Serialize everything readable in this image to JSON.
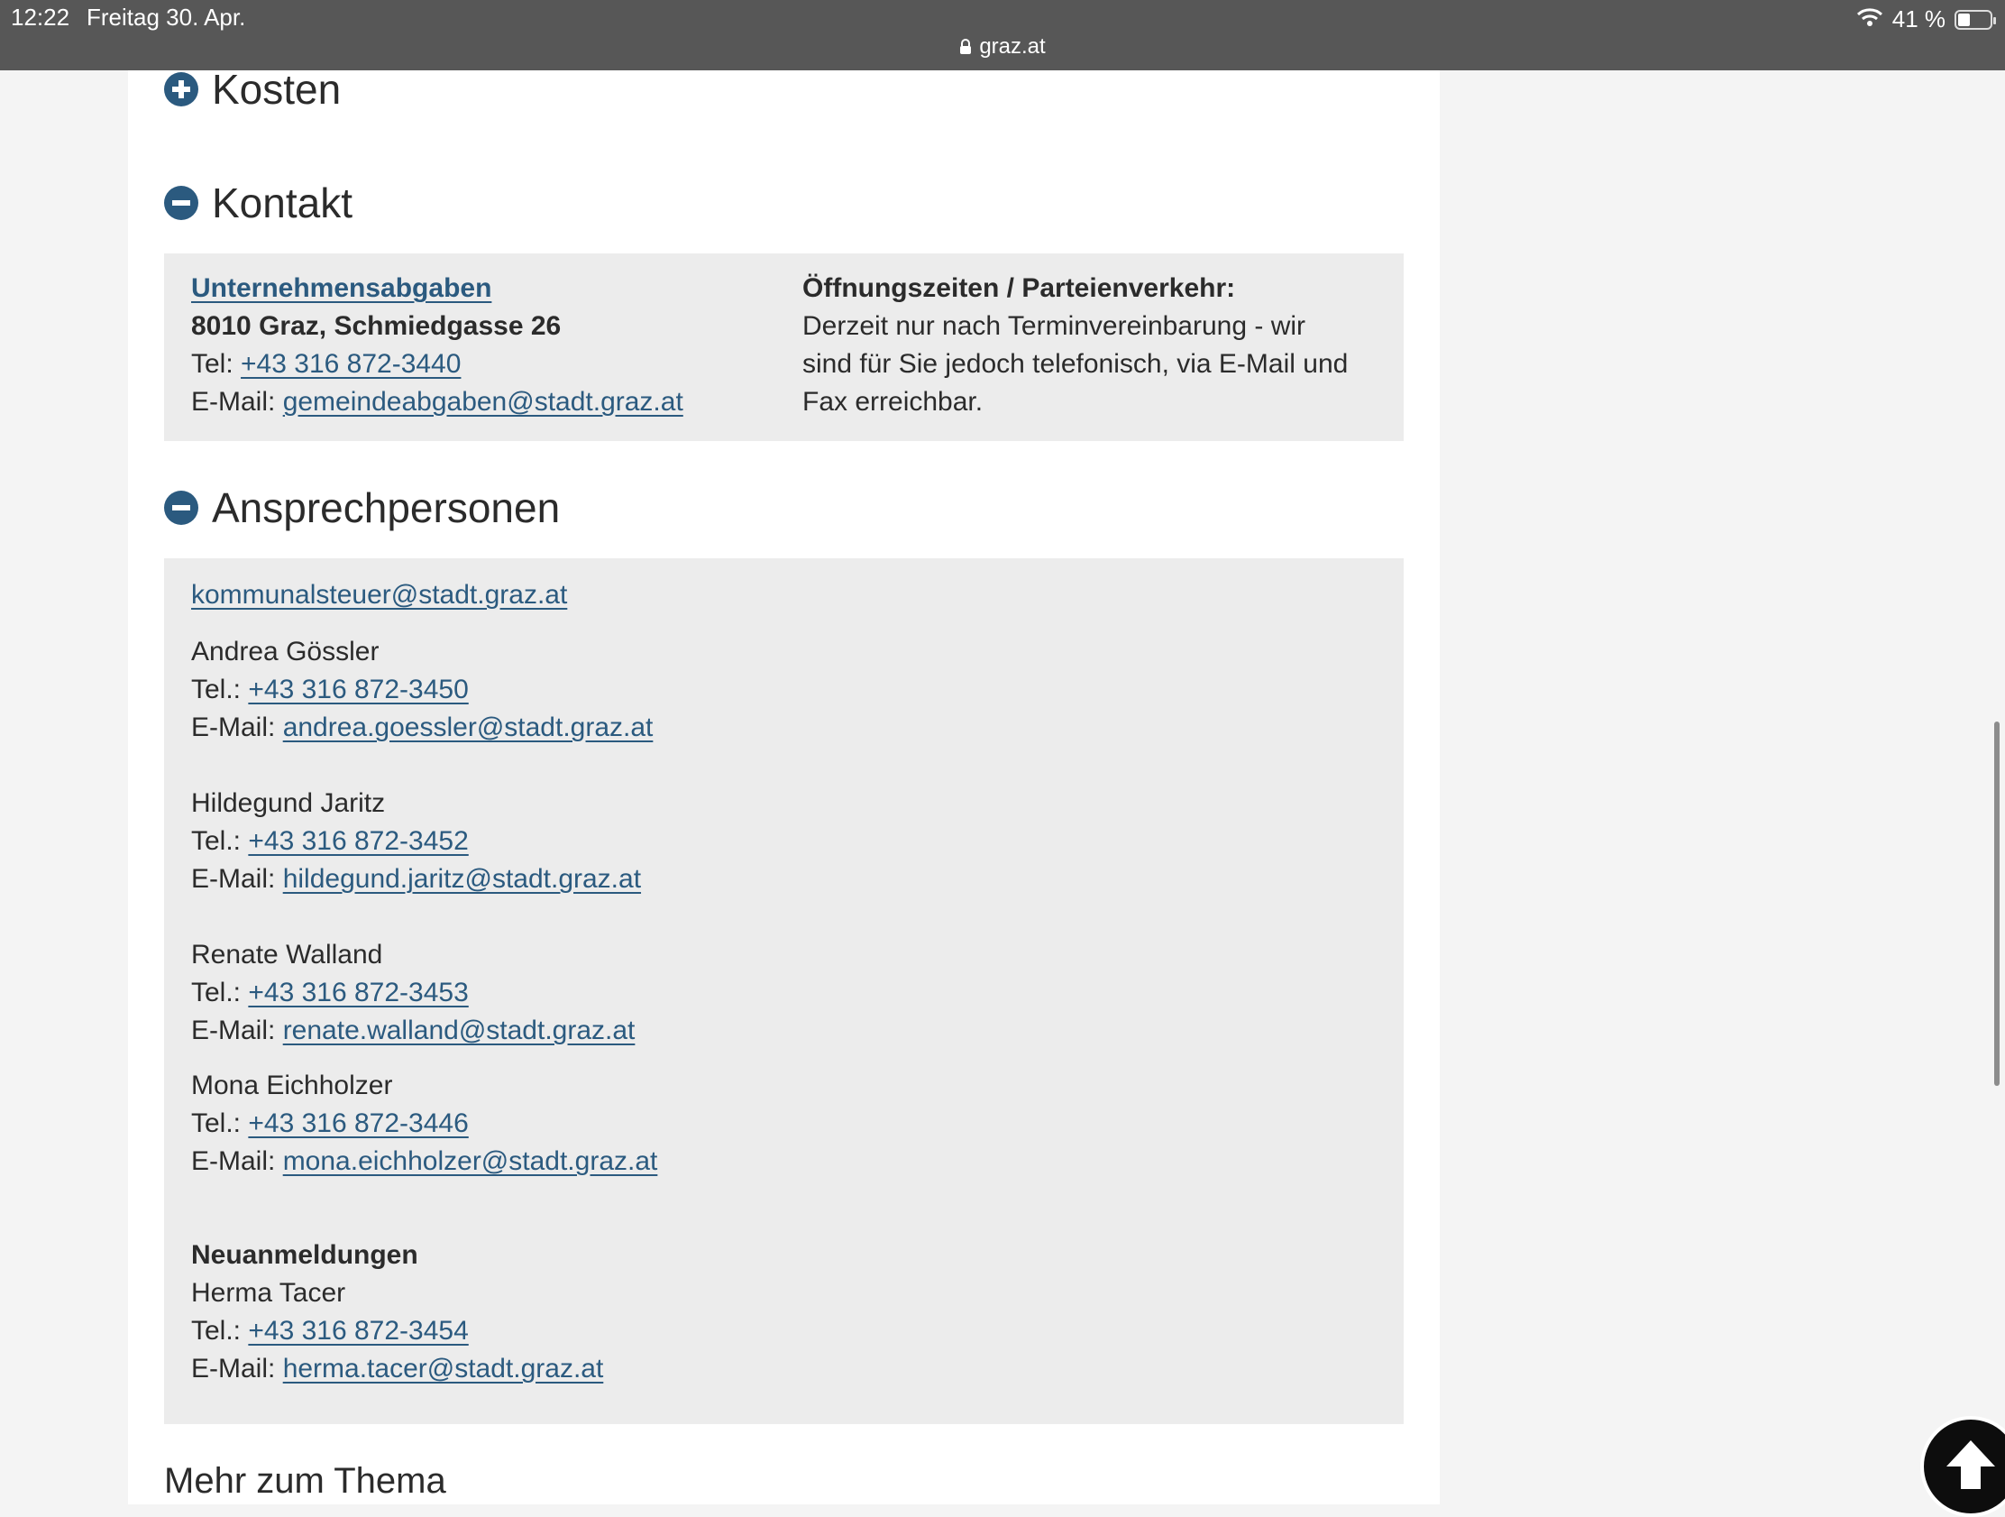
{
  "statusbar": {
    "time": "12:22",
    "date": "Freitag 30. Apr.",
    "url": "graz.at",
    "battery": "41 %",
    "battery_level": 0.41
  },
  "sections": {
    "kosten": "Kosten",
    "kontakt": "Kontakt",
    "ansprechpersonen": "Ansprechpersonen"
  },
  "kontakt": {
    "org_link": "Unternehmensabgaben",
    "address": "8010 Graz, Schmiedgasse 26",
    "tel_label": "Tel: ",
    "tel": "+43 316 872-3440",
    "email_label": "E-Mail: ",
    "email": "gemeindeabgaben@stadt.graz.at",
    "hours_title": "Öffnungszeiten / Parteienverkehr:",
    "hours_lines": [
      "Derzeit nur nach Terminvereinbarung - wir",
      "sind für Sie jedoch telefonisch, via E-Mail und",
      "Fax erreichbar."
    ]
  },
  "ansprechpersonen": {
    "general_email": "kommunalsteuer@stadt.graz.at",
    "tel_label": "Tel.: ",
    "email_label": "E-Mail: ",
    "persons": [
      {
        "name": "Andrea Gössler",
        "tel": "+43 316 872-3450",
        "email": "andrea.goessler@stadt.graz.at"
      },
      {
        "name": "Hildegund Jaritz",
        "tel": "+43 316 872-3452",
        "email": "hildegund.jaritz@stadt.graz.at"
      },
      {
        "name": "Renate Walland",
        "tel": "+43 316 872-3453",
        "email": "renate.walland@stadt.graz.at"
      },
      {
        "name": "Mona Eichholzer",
        "tel": "+43 316 872-3446",
        "email": "mona.eichholzer@stadt.graz.at"
      }
    ],
    "neuanmeldungen_title": "Neuanmeldungen",
    "neu_person": {
      "name": "Herma Tacer",
      "tel": "+43 316 872-3454",
      "email": "herma.tacer@stadt.graz.at"
    }
  },
  "mehr_zum_thema": "Mehr zum Thema",
  "colors": {
    "accent": "#2b5a7f",
    "box_bg": "#ececec",
    "statusbar_bg": "#575757"
  }
}
